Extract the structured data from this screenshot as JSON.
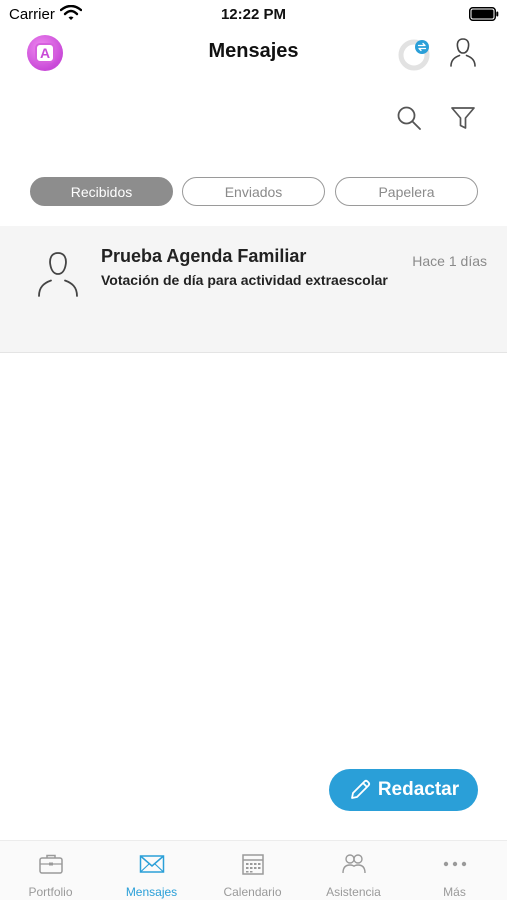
{
  "status_bar": {
    "carrier": "Carrier",
    "time": "12:22 PM"
  },
  "header": {
    "title": "Mensajes",
    "logo_letter": "A"
  },
  "segments": [
    {
      "label": "Recibidos",
      "active": true
    },
    {
      "label": "Enviados",
      "active": false
    },
    {
      "label": "Papelera",
      "active": false
    }
  ],
  "messages": [
    {
      "sender": "Prueba Agenda Familiar",
      "subject": "Votación de día para actividad extraescolar",
      "time": "Hace 1 días"
    }
  ],
  "compose": {
    "label": "Redactar"
  },
  "tabs": [
    {
      "label": "Portfolio",
      "icon": "briefcase-icon",
      "active": false
    },
    {
      "label": "Mensajes",
      "icon": "envelope-icon",
      "active": true
    },
    {
      "label": "Calendario",
      "icon": "calendar-icon",
      "active": false
    },
    {
      "label": "Asistencia",
      "icon": "people-icon",
      "active": false
    },
    {
      "label": "Más",
      "icon": "more-icon",
      "active": false
    }
  ],
  "colors": {
    "accent": "#2a9fd8",
    "active_segment": "#8d8d8d",
    "logo": "#c94ad8",
    "row_background": "#f5f5f5"
  }
}
